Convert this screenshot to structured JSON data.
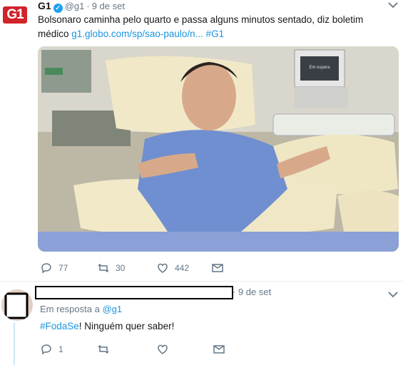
{
  "tweet": {
    "display_name": "G1",
    "handle": "@g1",
    "date": "9 de set",
    "text": "Bolsonaro caminha pelo quarto e passa alguns minutos sentado, diz boletim médico ",
    "link": "g1.globo.com/sp/sao-paulo/n...",
    "hashtag": "#G1",
    "reply_count": "77",
    "retweet_count": "30",
    "like_count": "442",
    "photo_monitor_text": "Em espera"
  },
  "reply": {
    "date": "9 de set",
    "replying_to_prefix": "Em resposta a",
    "replying_to_handle": "@g1",
    "hashtag": "#FodaSe",
    "text": "! Ninguém quer saber!",
    "reply_count": "1"
  },
  "logo_text": "G1",
  "colors": {
    "accent": "#1da1f2",
    "link": "#1b95e0",
    "muted": "#657786",
    "brand": "#d2232a"
  }
}
